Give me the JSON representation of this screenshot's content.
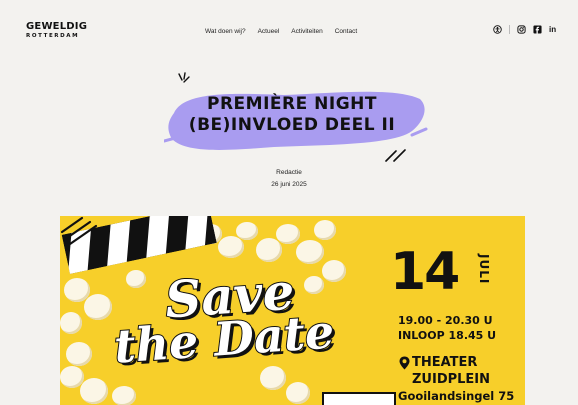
{
  "brand": {
    "line1": "GEWELDIG",
    "line2": "ROTTERDAM"
  },
  "nav": [
    {
      "label": "Wat doen wij?"
    },
    {
      "label": "Actueel"
    },
    {
      "label": "Activiteiten"
    },
    {
      "label": "Contact"
    }
  ],
  "social": {
    "icons": [
      "accessibility-icon",
      "instagram-icon",
      "facebook-icon",
      "linkedin-icon"
    ],
    "linkedin_text": "in",
    "facebook_text": "f"
  },
  "article": {
    "title_line1": "PREMIÈRE NIGHT",
    "title_line2": "(BE)INVLOED DEEL II",
    "author": "Redactie",
    "date": "26 juni 2025"
  },
  "poster": {
    "headline_line1": "Save",
    "headline_line2": "the Date",
    "day": "14",
    "month": "JULI",
    "time": "19.00 - 20.30 U",
    "entry": "INLOOP 18.45 U",
    "venue_line1": "THEATER",
    "venue_line2": "ZUIDPLEIN",
    "address": "Gooilandsingel 75",
    "pin_icon": "map-pin-icon",
    "background_color": "#f7cf2a"
  },
  "colors": {
    "brush": "#a99cf0",
    "text": "#111111",
    "background": "#f3f2ef"
  }
}
